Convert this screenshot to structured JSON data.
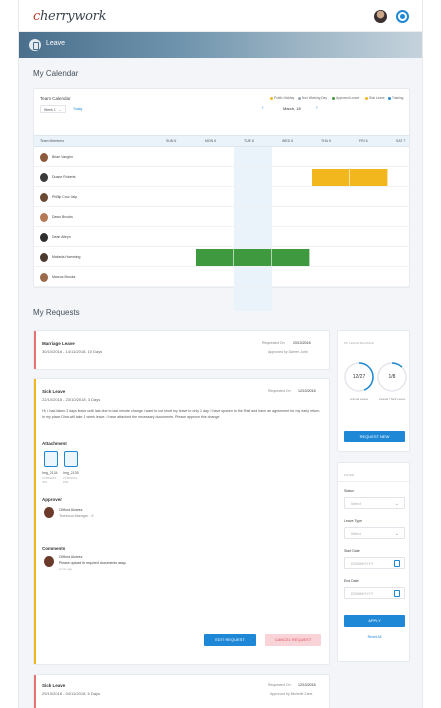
{
  "app": {
    "logo_part1": "c",
    "logo_part2": "herrywork"
  },
  "nav": {
    "label": "Leave"
  },
  "calendar": {
    "section_title": "My Calendar",
    "card_title": "Team Calendar",
    "week_select": "Week 1",
    "today_link": "Today",
    "month_label": "March, 18",
    "prev_arrow": "‹",
    "next_arrow": "›",
    "legend": [
      {
        "label": "Public Holiday",
        "color": "#f2b71c"
      },
      {
        "label": "Non Working Day",
        "color": "#9aa5ae"
      },
      {
        "label": "Approved Leave",
        "color": "#3f9a3f"
      },
      {
        "label": "Sick Leave",
        "color": "#f2b71c"
      },
      {
        "label": "Training",
        "color": "#1e88d6"
      }
    ],
    "members_header": "Team Members",
    "days": [
      "SUN 6",
      "MON 6",
      "TUE 6",
      "WED 6",
      "THU 6",
      "FRI 6",
      "SAT 7"
    ],
    "members": [
      "Brian Vaughn",
      "Duane Roberts",
      "Phillip Cruz Jalp",
      "Dawn Brooks",
      "Dean Alleyn",
      "Makeda Hamming",
      "Marcus Brooks"
    ]
  },
  "requests": {
    "section_title": "My Requests",
    "items": [
      {
        "type": "Marriage Leave",
        "dates": "30/10/2018 - 14/11/2018, 10 Days",
        "requested_label": "Requested On",
        "requested_on": "20/10/2018",
        "approved_text": "Approved by Darren John"
      },
      {
        "type": "Sick Leave",
        "dates": "22/10/2018 - 23/10/2018, 3 Days",
        "requested_label": "Requested On",
        "requested_on": "12/10/2018",
        "message": "Hi, I had taken 3 days leave until last due to last minute change I want to cut short my leave to only 1 day. I have spoken to the Raif and have an agreement for my early return. In my place Dina will take 1 week leave. I have attached the necessary documents. Please approve this change.",
        "attachment_title": "Attachment",
        "attachments": [
          {
            "name": "Img_2134",
            "meta": "27/05/2019 · JPG"
          },
          {
            "name": "Img_2135",
            "meta": "27/05/2019 · PDF"
          }
        ],
        "approver_title": "Approver",
        "approver_name": "Clifford Alvarez",
        "approver_role": "Technical Manager - II",
        "comments_title": "Comments",
        "comment_author": "Clifford Alvarez",
        "comment_text": "Please upload th required documents asap.",
        "comment_time": "2 min ago",
        "edit_button": "EDIT REQUEST",
        "cancel_button": "CANCEL REQUEST"
      },
      {
        "type": "Sick Leave",
        "dates": "29/10/2018 - 04/11/2018, 5 Days",
        "requested_label": "Requested On",
        "requested_on": "12/10/2018",
        "approved_text": "Approved by Michelle Zane"
      }
    ]
  },
  "balance": {
    "title": "MY LEAVE BALANCE",
    "annual_value": "12/27",
    "annual_label": "Annual Leave",
    "annual_fraction": 0.44,
    "casual_value": "1/8",
    "casual_label": "Casual / Sick Leave",
    "casual_fraction": 0.125,
    "request_button": "REQUEST NEW"
  },
  "filter": {
    "title": "FILTER",
    "status_label": "Status",
    "status_placeholder": "Select",
    "type_label": "Leave Type",
    "type_placeholder": "Select",
    "start_label": "Start Date",
    "start_placeholder": "DD/MM/YYYY",
    "end_label": "End Date",
    "end_placeholder": "DD/MM/YYYY",
    "apply_button": "APPLY",
    "reset_link": "Reset All"
  }
}
